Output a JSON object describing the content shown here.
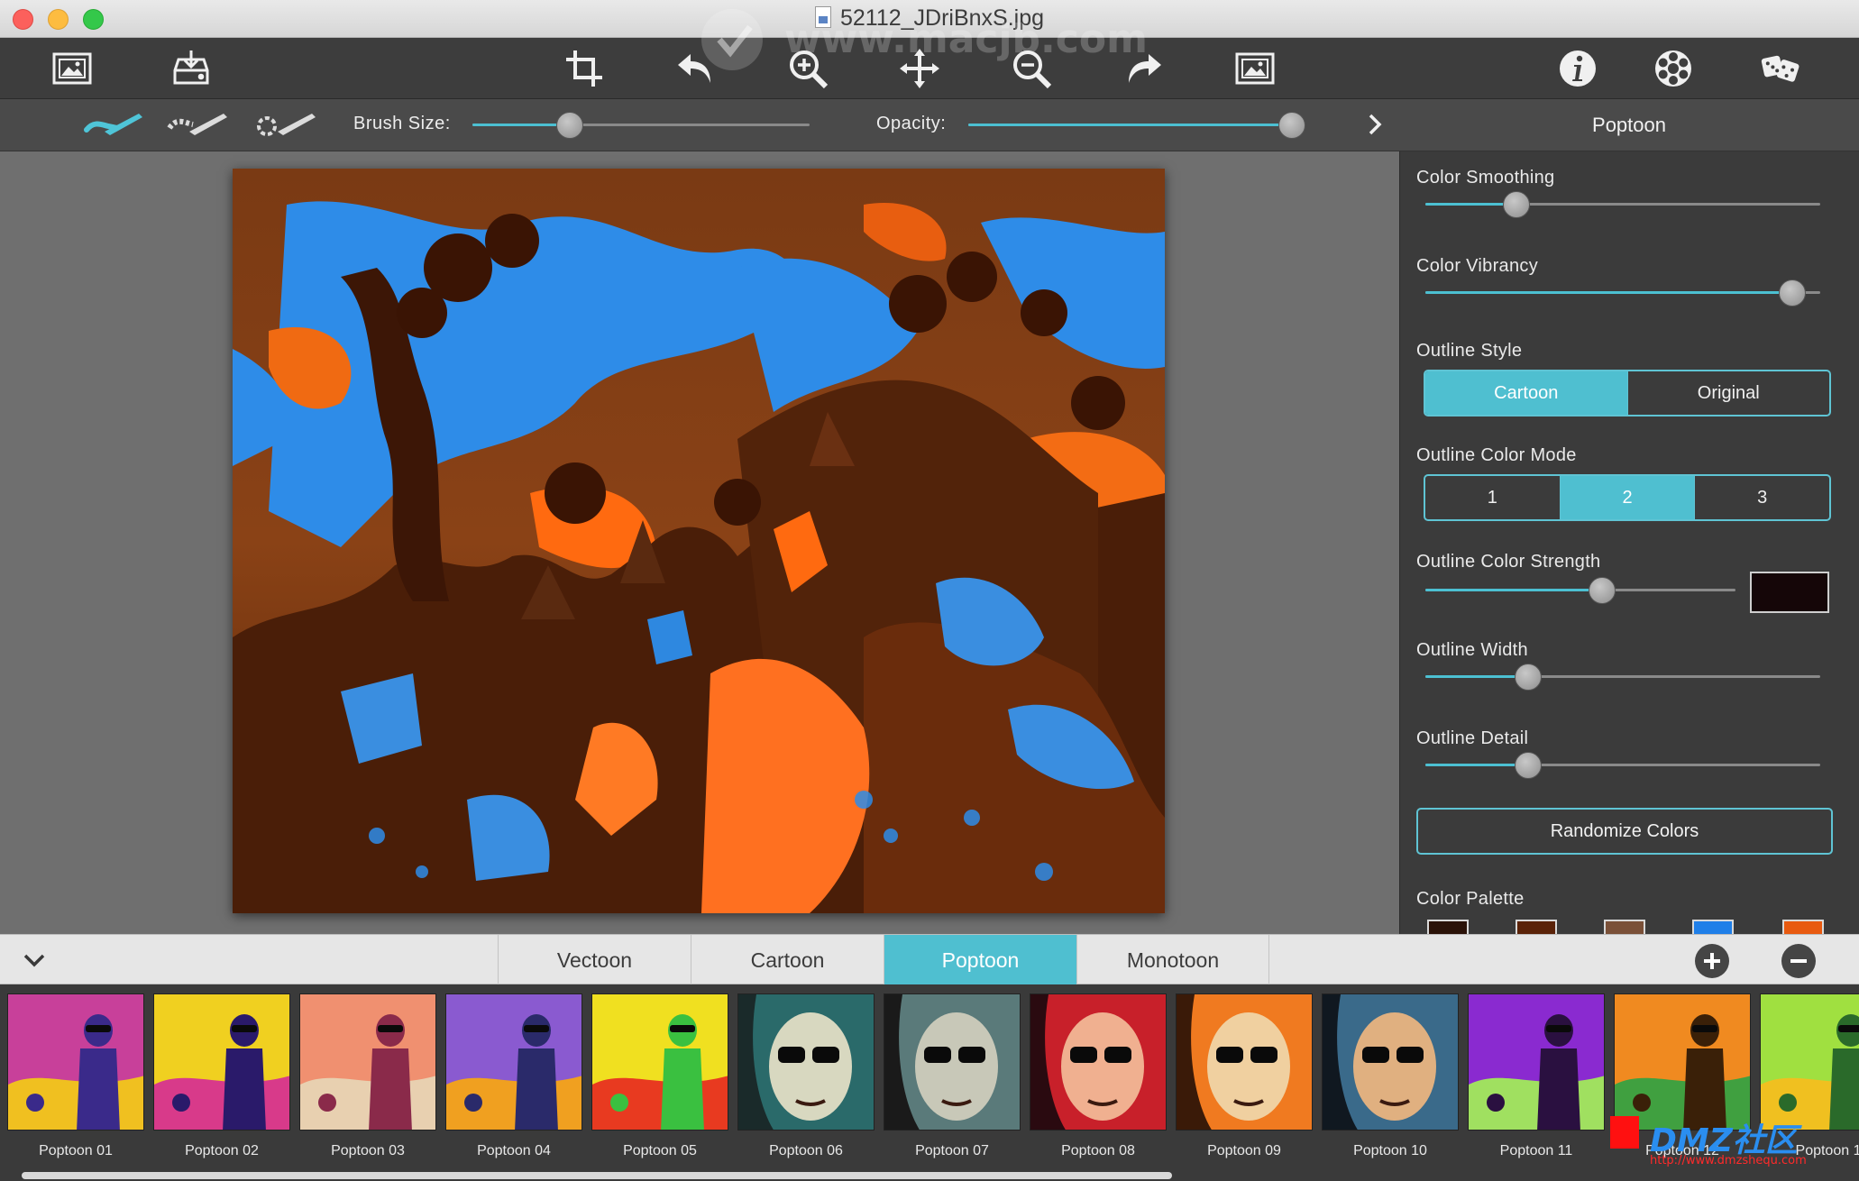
{
  "window": {
    "title": "52112_JDriBnxS.jpg"
  },
  "toolbar": {
    "left": [
      {
        "name": "open-image-icon"
      },
      {
        "name": "export-icon"
      }
    ],
    "center": [
      {
        "name": "crop-icon"
      },
      {
        "name": "undo-icon"
      },
      {
        "name": "zoom-in-icon"
      },
      {
        "name": "move-icon"
      },
      {
        "name": "zoom-out-icon"
      },
      {
        "name": "redo-icon"
      },
      {
        "name": "compare-icon"
      }
    ],
    "right": [
      {
        "name": "info-icon"
      },
      {
        "name": "effects-icon"
      },
      {
        "name": "dice-icon"
      }
    ]
  },
  "subbar": {
    "brush_size_label": "Brush Size:",
    "brush_size_value": 0.29,
    "opacity_label": "Opacity:",
    "opacity_value": 0.96,
    "panel_title": "Poptoon"
  },
  "panel": {
    "color_smoothing": {
      "label": "Color Smoothing",
      "value": 0.23
    },
    "color_vibrancy": {
      "label": "Color Vibrancy",
      "value": 0.93
    },
    "outline_style": {
      "label": "Outline Style",
      "options": [
        "Cartoon",
        "Original"
      ],
      "selected": "Cartoon"
    },
    "outline_color_mode": {
      "label": "Outline Color Mode",
      "options": [
        "1",
        "2",
        "3"
      ],
      "selected": "2"
    },
    "outline_color_strength": {
      "label": "Outline Color Strength",
      "value": 0.57,
      "color": "#150608"
    },
    "outline_width": {
      "label": "Outline Width",
      "value": 0.26
    },
    "outline_detail": {
      "label": "Outline Detail",
      "value": 0.26
    },
    "randomize_label": "Randomize Colors",
    "color_palette": {
      "label": "Color Palette",
      "swatches": [
        "#2a1208",
        "#5a2208",
        "#7a5038",
        "#1f7fe8",
        "#e85a10"
      ]
    }
  },
  "tabs": {
    "items": [
      "Vectoon",
      "Cartoon",
      "Poptoon",
      "Monotoon"
    ],
    "active": "Poptoon"
  },
  "presets": [
    {
      "label": "Poptoon 01"
    },
    {
      "label": "Poptoon 02"
    },
    {
      "label": "Poptoon 03"
    },
    {
      "label": "Poptoon 04"
    },
    {
      "label": "Poptoon 05"
    },
    {
      "label": "Poptoon 06"
    },
    {
      "label": "Poptoon 07"
    },
    {
      "label": "Poptoon 08"
    },
    {
      "label": "Poptoon 09"
    },
    {
      "label": "Poptoon 10"
    },
    {
      "label": "Poptoon 11"
    },
    {
      "label": "Poptoon 12"
    },
    {
      "label": "Poptoon 1"
    }
  ],
  "watermarks": {
    "top": "www.macjb.com",
    "bottom": "DMZ社区",
    "bottom_url": "http://www.dmzshequ.com"
  },
  "accent_color": "#4fbfd0"
}
